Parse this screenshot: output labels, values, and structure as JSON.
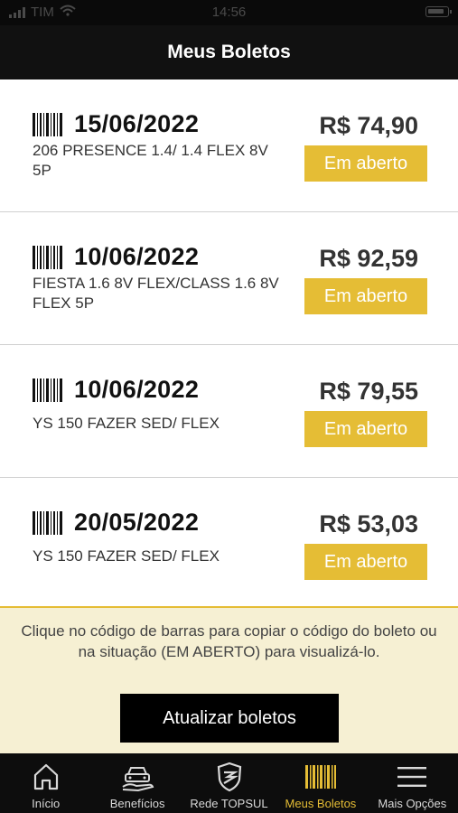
{
  "status_bar": {
    "carrier": "TIM",
    "time": "14:56"
  },
  "header": {
    "title": "Meus Boletos"
  },
  "boletos": [
    {
      "date": "15/06/2022",
      "description": "206 PRESENCE 1.4/ 1.4 FLEX 8V 5P",
      "amount": "R$ 74,90",
      "status": "Em aberto"
    },
    {
      "date": "10/06/2022",
      "description": "FIESTA 1.6 8V FLEX/CLASS 1.6 8V FLEX 5P",
      "amount": "R$ 92,59",
      "status": "Em aberto"
    },
    {
      "date": "10/06/2022",
      "description": "YS 150 FAZER SED/ FLEX",
      "amount": "R$ 79,55",
      "status": "Em aberto"
    },
    {
      "date": "20/05/2022",
      "description": "YS 150 FAZER SED/ FLEX",
      "amount": "R$ 53,03",
      "status": "Em aberto"
    }
  ],
  "info": {
    "message": "Clique no código de barras para copiar o código do boleto ou na situação (EM ABERTO) para visualizá-lo.",
    "refresh_label": "Atualizar boletos"
  },
  "tabs": [
    {
      "label": "Início",
      "icon": "home-icon"
    },
    {
      "label": "Benefícios",
      "icon": "car-hand-icon"
    },
    {
      "label": "Rede TOPSUL",
      "icon": "shield-logo-icon"
    },
    {
      "label": "Meus Boletos",
      "icon": "barcode-icon"
    },
    {
      "label": "Mais Opções",
      "icon": "menu-icon"
    }
  ],
  "colors": {
    "accent": "#e5bd35",
    "header_bg": "#111111",
    "info_bg": "#f6f0d3"
  }
}
